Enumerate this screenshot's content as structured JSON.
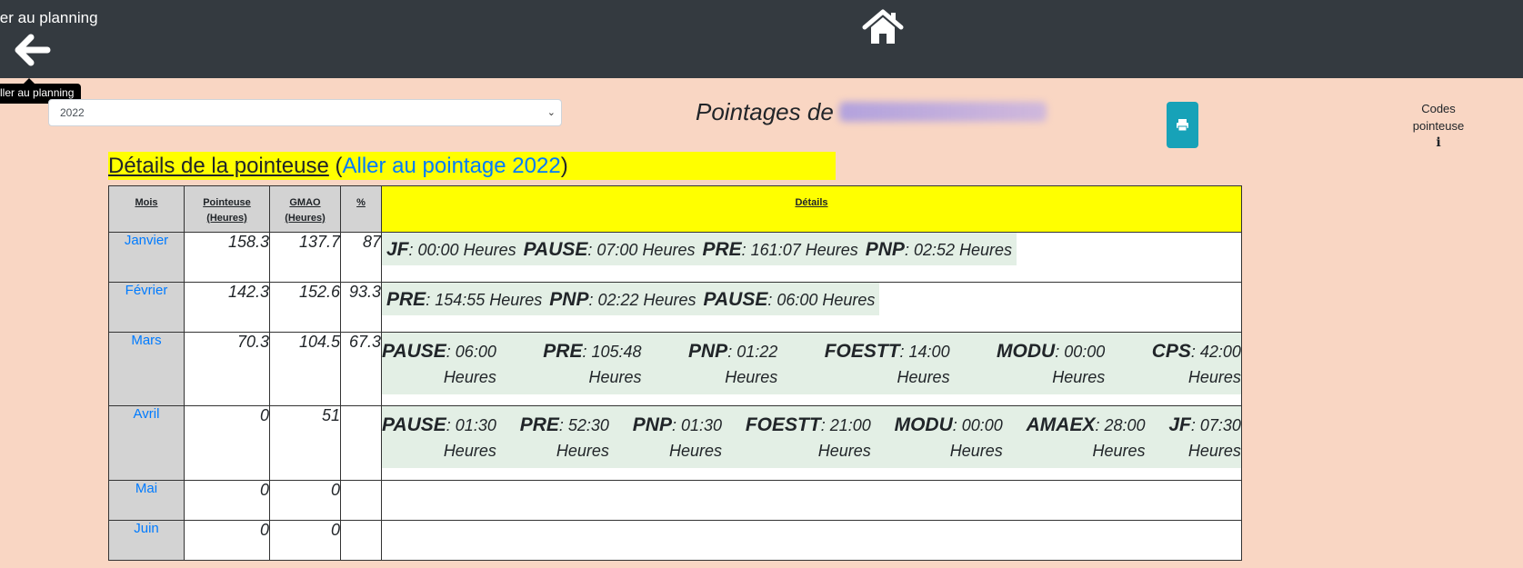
{
  "nav": {
    "back_label": "ler au planning",
    "back_tooltip": "ller au planning"
  },
  "year_select": {
    "value": "2022"
  },
  "title": {
    "prefix": "Pointages de"
  },
  "codes": {
    "line1": "Codes",
    "line2": "pointeuse",
    "info": "i"
  },
  "section": {
    "title": "Détails de la pointeuse",
    "open": "(",
    "link": "Aller au pointage 2022",
    "close": ")"
  },
  "table": {
    "headers": {
      "mois": "Mois",
      "pointeuse1": "Pointeuse",
      "pointeuse2": "(Heures)",
      "gmao1": "GMAO",
      "gmao2": "(Heures)",
      "pct": "%",
      "details": "Détails"
    },
    "rows": [
      {
        "month": "Janvier",
        "pointeuse": "158.3",
        "gmao": "137.7",
        "pct": "87",
        "details": [
          {
            "code": "JF",
            "value": ": 00:00 Heures"
          },
          {
            "code": "PAUSE",
            "value": ": 07:00 Heures"
          },
          {
            "code": "PRE",
            "value": ": 161:07 Heures"
          },
          {
            "code": "PNP",
            "value": ": 02:52 Heures"
          }
        ]
      },
      {
        "month": "Février",
        "pointeuse": "142.3",
        "gmao": "152.6",
        "pct": "93.3",
        "details": [
          {
            "code": "PRE",
            "value": ": 154:55 Heures"
          },
          {
            "code": "PNP",
            "value": ": 02:22 Heures"
          },
          {
            "code": "PAUSE",
            "value": ": 06:00 Heures"
          }
        ]
      },
      {
        "month": "Mars",
        "pointeuse": "70.3",
        "gmao": "104.5",
        "pct": "67.3",
        "details": [
          {
            "code": "PAUSE",
            "value": ": 06:00",
            "unit": "Heures"
          },
          {
            "code": "PRE",
            "value": ": 105:48",
            "unit": "Heures"
          },
          {
            "code": "PNP",
            "value": ": 01:22",
            "unit": "Heures"
          },
          {
            "code": "FOESTT",
            "value": ": 14:00",
            "unit": "Heures"
          },
          {
            "code": "MODU",
            "value": ": 00:00",
            "unit": "Heures"
          },
          {
            "code": "CPS",
            "value": ": 42:00",
            "unit": "Heures"
          }
        ]
      },
      {
        "month": "Avril",
        "pointeuse": "0",
        "gmao": "51",
        "pct": "",
        "details": [
          {
            "code": "PAUSE",
            "value": ": 01:30",
            "unit": "Heures"
          },
          {
            "code": "PRE",
            "value": ": 52:30",
            "unit": "Heures"
          },
          {
            "code": "PNP",
            "value": ": 01:30",
            "unit": "Heures"
          },
          {
            "code": "FOESTT",
            "value": ": 21:00",
            "unit": "Heures"
          },
          {
            "code": "MODU",
            "value": ": 00:00",
            "unit": "Heures"
          },
          {
            "code": "AMAEX",
            "value": ": 28:00",
            "unit": "Heures"
          },
          {
            "code": "JF",
            "value": ": 07:30",
            "unit": "Heures"
          }
        ]
      },
      {
        "month": "Mai",
        "pointeuse": "0",
        "gmao": "0",
        "pct": "",
        "details": []
      },
      {
        "month": "Juin",
        "pointeuse": "0",
        "gmao": "0",
        "pct": "",
        "details": []
      }
    ]
  }
}
